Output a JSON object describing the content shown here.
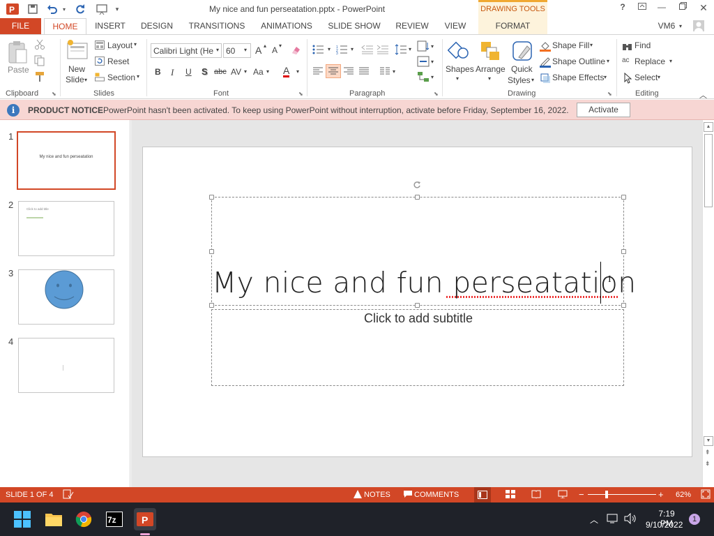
{
  "titlebar": {
    "doc_title": "My nice and fun perseatation.pptx - PowerPoint",
    "contextual_label": "DRAWING TOOLS",
    "help": "?"
  },
  "tabs": [
    "FILE",
    "HOME",
    "INSERT",
    "DESIGN",
    "TRANSITIONS",
    "ANIMATIONS",
    "SLIDE SHOW",
    "REVIEW",
    "VIEW",
    "FORMAT"
  ],
  "user": "VM6",
  "ribbon": {
    "clipboard": {
      "paste": "Paste",
      "label": "Clipboard"
    },
    "slides": {
      "new_slide_1": "New",
      "new_slide_2": "Slide",
      "layout": "Layout",
      "reset": "Reset",
      "section": "Section",
      "label": "Slides"
    },
    "font": {
      "font_name": "Calibri Light (He",
      "font_size": "60",
      "bold": "B",
      "italic": "I",
      "underline": "U",
      "shadow": "S",
      "strike": "abc",
      "spacing": "AV",
      "case": "Aa",
      "color": "A",
      "grow": "A",
      "shrink": "A",
      "label": "Font"
    },
    "paragraph": {
      "label": "Paragraph"
    },
    "drawing": {
      "shapes": "Shapes",
      "arrange": "Arrange",
      "quick_styles_1": "Quick",
      "quick_styles_2": "Styles",
      "shape_fill": "Shape Fill",
      "shape_outline": "Shape Outline",
      "shape_effects": "Shape Effects",
      "label": "Drawing"
    },
    "editing": {
      "find": "Find",
      "replace": "Replace",
      "select": "Select",
      "label": "Editing"
    }
  },
  "notice": {
    "title": "PRODUCT NOTICE",
    "message": "PowerPoint hasn't been activated. To keep using PowerPoint without interruption, activate before Friday, September 16, 2022.",
    "button": "Activate"
  },
  "thumbnails": [
    {
      "num": "1",
      "text": "My nice and fun perseatation"
    },
    {
      "num": "2",
      "text": "Click to add title"
    },
    {
      "num": "3",
      "text": ""
    },
    {
      "num": "4",
      "text": ""
    }
  ],
  "slide": {
    "title": "My nice and fun perseatation",
    "subtitle": "Click to add subtitle"
  },
  "status": {
    "slide_info": "SLIDE 1 OF 4",
    "notes": "NOTES",
    "comments": "COMMENTS",
    "zoom": "62%"
  },
  "taskbar": {
    "time": "7:19 PM",
    "date": "9/10/2022",
    "notification_count": "1",
    "apps": [
      "start",
      "file-explorer",
      "chrome",
      "7zip",
      "powerpoint"
    ]
  },
  "colors": {
    "accent": "#d24726",
    "notice_bg": "#f7d6d3",
    "taskbar": "#1f2229"
  }
}
